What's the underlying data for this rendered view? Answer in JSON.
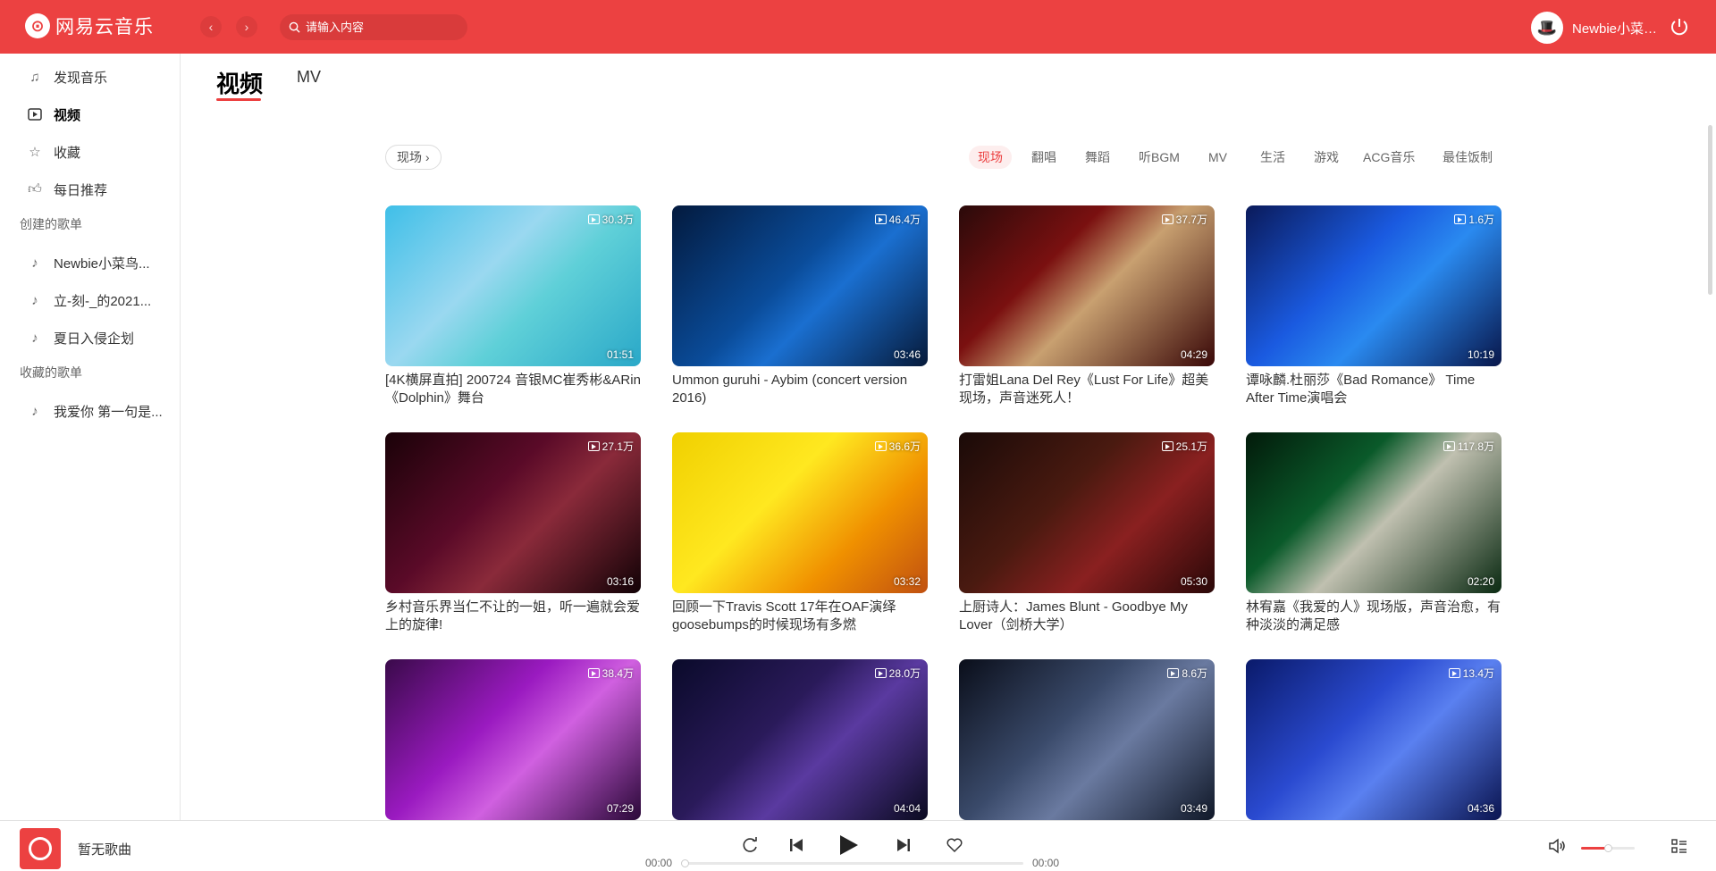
{
  "app": {
    "logo_text": "网易云音乐",
    "search_placeholder": "请输入内容",
    "user_name": "Newbie小菜…"
  },
  "colors": {
    "accent": "#ec4141",
    "topbar": "#ec4141"
  },
  "sidebar": {
    "items": [
      {
        "label": "发现音乐",
        "icon": "music-note-icon"
      },
      {
        "label": "视频",
        "icon": "video-icon",
        "active": true
      },
      {
        "label": "收藏",
        "icon": "star-icon"
      },
      {
        "label": "每日推荐",
        "icon": "thumbs-up-icon"
      }
    ],
    "created_header": "创建的歌单",
    "created": [
      "Newbie小菜鸟...",
      "立-刻-_的2021...",
      "夏日入侵企划"
    ],
    "collected_header": "收藏的歌单",
    "collected": [
      "我爱你 第一句是..."
    ]
  },
  "tabs": [
    "视频",
    "MV"
  ],
  "filter": {
    "label": "现场 ›"
  },
  "categories": [
    "现场",
    "翻唱",
    "舞蹈",
    "听BGM",
    "MV",
    "生活",
    "游戏",
    "ACG音乐",
    "最佳饭制"
  ],
  "videos": [
    {
      "count": "30.3万",
      "duration": "01:51",
      "title": "[4K横屏直拍] 200724 音银MC崔秀彬&ARin《Dolphin》舞台",
      "thumb": "linear-gradient(135deg,#3fbfe8,#9ad8f0 40%,#5fd0d8 60%,#2aa8c8)"
    },
    {
      "count": "46.4万",
      "duration": "03:46",
      "title": "Ummon guruhi - Aybim (concert version 2016)",
      "thumb": "linear-gradient(135deg,#031a3e,#0a4c9a 45%,#1a6fd0 60%,#061a3a)"
    },
    {
      "count": "37.7万",
      "duration": "04:29",
      "title": "打雷姐Lana Del Rey《Lust For Life》超美现场，声音迷死人！",
      "thumb": "linear-gradient(135deg,#2a0a0a,#7a1010 35%,#c8a070 55%,#3a0808)"
    },
    {
      "count": "1.6万",
      "duration": "10:19",
      "title": "谭咏麟.杜丽莎《Bad Romance》 Time After Time演唱会",
      "thumb": "linear-gradient(135deg,#0a1a5a,#1a5ae0 40%,#2a8af0 60%,#08164a)"
    },
    {
      "count": "27.1万",
      "duration": "03:16",
      "title": "乡村音乐界当仁不让的一姐，听一遍就会爱上的旋律!",
      "thumb": "linear-gradient(135deg,#1a0208,#5a0a28 40%,#8a2a3a 60%,#120206)"
    },
    {
      "count": "36.6万",
      "duration": "03:32",
      "title": "回顾一下Travis Scott 17年在OAF演绎goosebumps的时候现场有多燃",
      "thumb": "linear-gradient(135deg,#f0d000,#ffe820 40%,#f09000 70%,#c05010)"
    },
    {
      "count": "25.1万",
      "duration": "05:30",
      "title": "上厨诗人：James Blunt - Goodbye My Lover（剑桥大学）",
      "thumb": "linear-gradient(135deg,#1a0a08,#4a1a10 40%,#8a2020 65%,#2a0808)"
    },
    {
      "count": "117.8万",
      "duration": "02:20",
      "title": "林宥嘉《我爱的人》现场版，声音治愈，有种淡淡的满足感",
      "thumb": "linear-gradient(135deg,#021a0a,#0a5a2a 35%,#c0c0b0 55%,#0a2a12)"
    },
    {
      "count": "38.4万",
      "duration": "07:29",
      "title": "",
      "thumb": "linear-gradient(135deg,#3a0a4a,#9a1ac0 40%,#d060e0 60%,#2a0838)"
    },
    {
      "count": "28.0万",
      "duration": "04:04",
      "title": "",
      "thumb": "linear-gradient(135deg,#0a0a2a,#2a1a5a 40%,#5a3aa0 60%,#0a0a20)"
    },
    {
      "count": "8.6万",
      "duration": "03:49",
      "title": "",
      "thumb": "linear-gradient(135deg,#0a0e1a,#3a4a6a 40%,#6a7aa0 60%,#101828)"
    },
    {
      "count": "13.4万",
      "duration": "04:36",
      "title": "",
      "thumb": "linear-gradient(135deg,#0a1a6a,#2a4ad0 40%,#5a80f0 60%,#0a1450)"
    }
  ],
  "player": {
    "song": "暂无歌曲",
    "time_current": "00:00",
    "time_total": "00:00",
    "progress": 0,
    "volume": 0.5
  }
}
